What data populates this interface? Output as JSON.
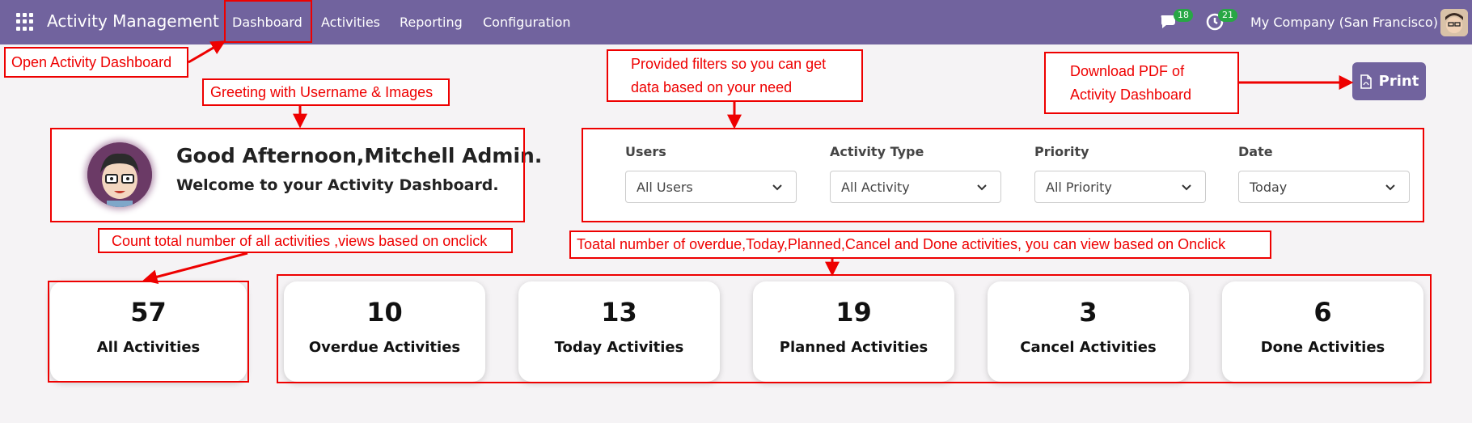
{
  "navbar": {
    "app_title": "Activity Management",
    "menu": {
      "dashboard": "Dashboard",
      "activities": "Activities",
      "reporting": "Reporting",
      "configuration": "Configuration"
    },
    "messages_count": "18",
    "activities_count": "21",
    "company": "My Company (San Francisco)",
    "color": "#71639e"
  },
  "annotations": {
    "open_dashboard": "Open Activity Dashboard",
    "greeting": "Greeting with Username & Images",
    "filters_line1": "Provided filters so you can get",
    "filters_line2": "data based on your need",
    "download_line1": "Download PDF of",
    "download_line2": "Activity Dashboard",
    "count_all": "Count total number of all activities ,views based on onclick",
    "count_each": "Toatal number of overdue,Today,Planned,Cancel and Done activities, you can view based on Onclick",
    "color": "#ee0000"
  },
  "print_button": {
    "label": "Print",
    "icon": "file-pdf-icon"
  },
  "greeting": {
    "title": "Good Afternoon,Mitchell Admin.",
    "subtitle": "Welcome to your Activity Dashboard."
  },
  "filters": {
    "users": {
      "label": "Users",
      "value": "All Users"
    },
    "activity_type": {
      "label": "Activity Type",
      "value": "All Activity"
    },
    "priority": {
      "label": "Priority",
      "value": "All Priority"
    },
    "date": {
      "label": "Date",
      "value": "Today"
    }
  },
  "stats": {
    "all": {
      "count": "57",
      "label": "All Activities"
    },
    "overdue": {
      "count": "10",
      "label": "Overdue Activities"
    },
    "today": {
      "count": "13",
      "label": "Today Activities"
    },
    "planned": {
      "count": "19",
      "label": "Planned Activities"
    },
    "cancel": {
      "count": "3",
      "label": "Cancel Activities"
    },
    "done": {
      "count": "6",
      "label": "Done Activities"
    }
  }
}
